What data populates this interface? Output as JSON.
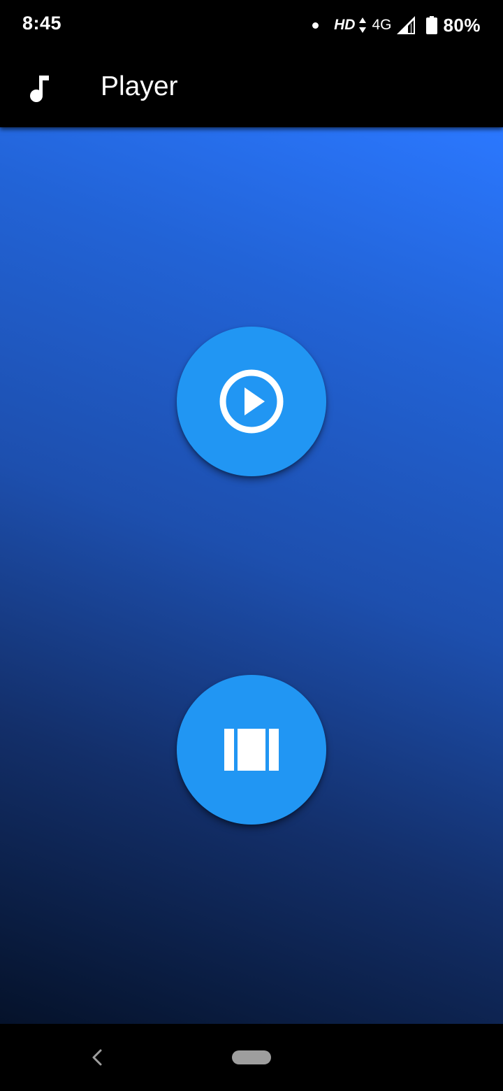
{
  "status_bar": {
    "time": "8:45",
    "hd": "HD",
    "network": "4G",
    "battery": "80%",
    "icons": [
      "notification-dot-icon",
      "data-arrows-icon",
      "signal-icon",
      "battery-icon"
    ]
  },
  "app_bar": {
    "icon": "music-note-icon",
    "title": "Player"
  },
  "main": {
    "play_button": {
      "icon": "play-circle-icon"
    },
    "stop_button": {
      "icon": "stop-bars-icon"
    }
  },
  "nav_bar": {
    "back": "back-chevron-icon",
    "home": "home-pill"
  },
  "colors": {
    "fab": "#2196f3",
    "gradient_top": "#2b78ff",
    "gradient_bottom": "#05122a",
    "bars": "#000000"
  }
}
